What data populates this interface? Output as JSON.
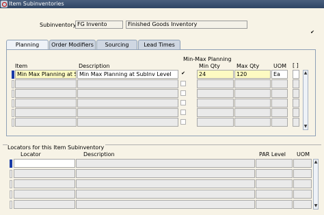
{
  "window": {
    "title": "Item Subinventories"
  },
  "header": {
    "subinventory_label": "Subinventory",
    "subinventory_code": "FG Invento",
    "subinventory_desc": "Finished Goods Inventory",
    "checkbox_mark": "✔"
  },
  "tabs": [
    {
      "label": "Planning"
    },
    {
      "label": "Order Modifiers"
    },
    {
      "label": "Sourcing"
    },
    {
      "label": "Lead Times"
    }
  ],
  "planning": {
    "item_header": "Item",
    "description_header": "Description",
    "minmax_header": "Min-Max Planning",
    "minqty_header": "Min Qty",
    "maxqty_header": "Max Qty",
    "uom_header": "UOM",
    "bracket_header": "[ ]",
    "rows": [
      {
        "item": "Min Max Planning at Su",
        "description": "Min Max Planning at SubInv Level",
        "check": "✔",
        "min_qty": "24",
        "max_qty": "120",
        "uom": "Ea"
      }
    ]
  },
  "locators": {
    "section_title": "Locators for this Item Subinventory",
    "locator_header": "Locator",
    "description_header": "Description",
    "par_level_header": "PAR Level",
    "uom_header": "UOM"
  },
  "icons": {
    "scroll_up": "up-arrow-icon",
    "scroll_down": "down-arrow-icon"
  }
}
